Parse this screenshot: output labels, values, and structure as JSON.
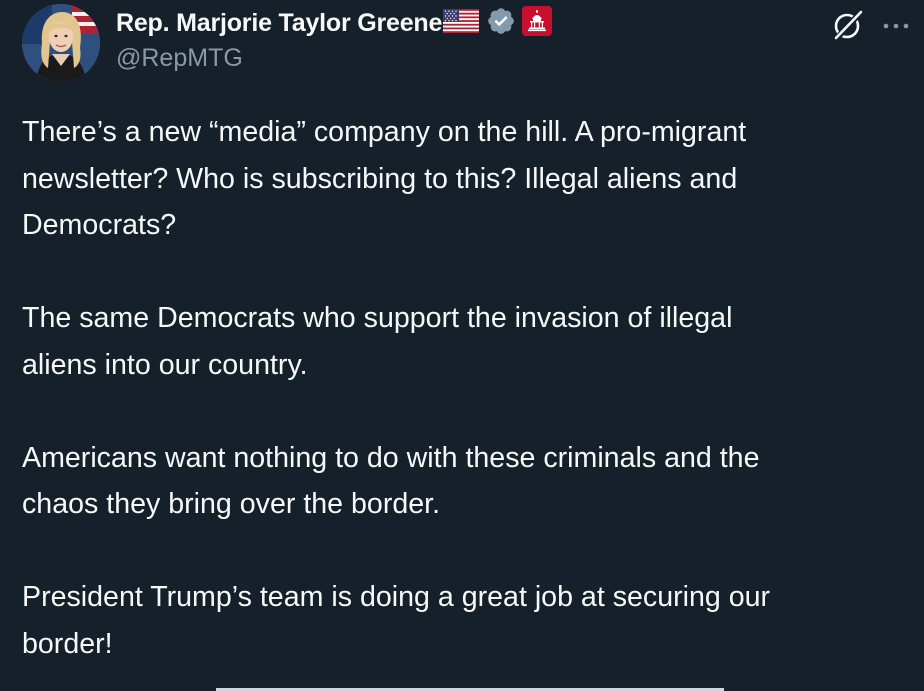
{
  "author": {
    "display_name": "Rep. Marjorie Taylor Greene",
    "handle": "@RepMTG",
    "flag_icon": "us-flag-icon",
    "verified_icon": "gray-verified-badge-icon",
    "affiliation_icon": "us-house-affiliation-icon",
    "colors": {
      "verified_gray": "#829aab",
      "affiliation_red": "#c8102e"
    }
  },
  "actions": {
    "grok_icon": "grok-icon",
    "more_icon": "more-options-icon"
  },
  "tweet": {
    "lines": [
      "There’s a new “media” company on the hill. A pro-migrant",
      "newsletter? Who is subscribing to this? Illegal aliens and",
      "Democrats?",
      "",
      "The same Democrats who support the invasion of illegal",
      "aliens into our country.",
      "",
      "Americans want nothing to do with these criminals and the",
      "chaos they bring over the border.",
      "",
      "President Trump’s team is doing a great job at securing our",
      "border!"
    ]
  },
  "theme": {
    "background": "#15202b",
    "text": "#f7f9f9",
    "secondary_text": "#8b98a5"
  }
}
